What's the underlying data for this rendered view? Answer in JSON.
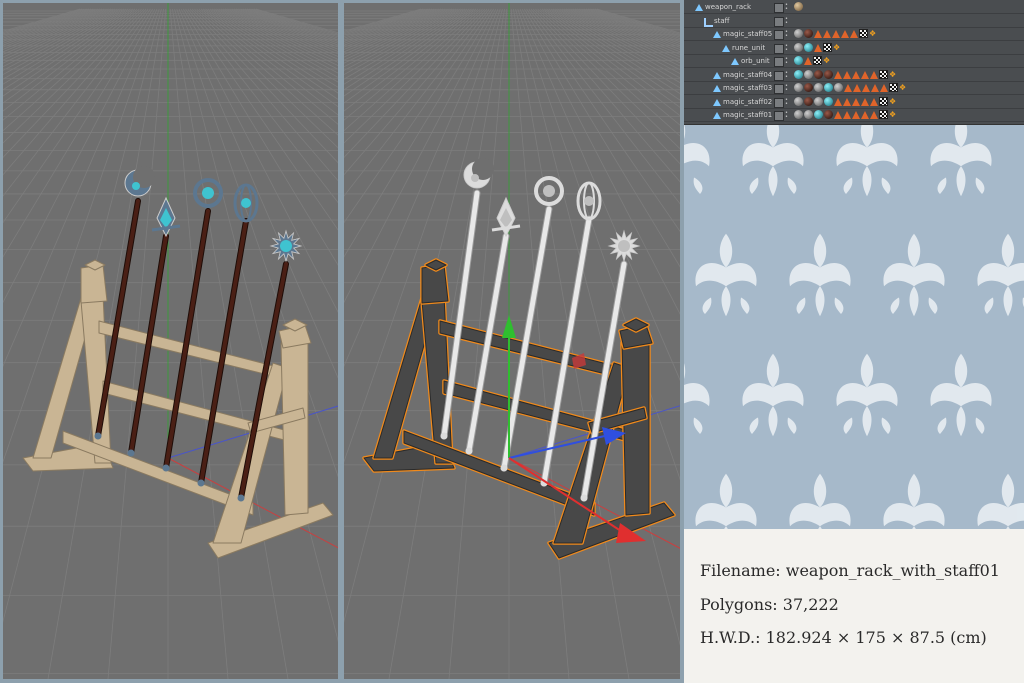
{
  "outliner": {
    "rows": [
      {
        "name": "weapon_rack",
        "kind": "null",
        "depth": 0,
        "tags": [
          "ball-brown"
        ]
      },
      {
        "name": "staff",
        "kind": "lod",
        "depth": 1,
        "tags": []
      },
      {
        "name": "magic_staff05",
        "kind": "poly",
        "depth": 2,
        "tags": [
          "ball-grey",
          "ball-dark",
          "tri",
          "tri",
          "tri",
          "tri",
          "tri",
          "checker",
          "phong"
        ]
      },
      {
        "name": "rune_unit",
        "kind": "poly",
        "depth": 3,
        "tags": [
          "ball-grey",
          "ball-cyan",
          "tri",
          "checker",
          "phong"
        ]
      },
      {
        "name": "orb_unit",
        "kind": "poly",
        "depth": 4,
        "tags": [
          "ball-cyan",
          "tri",
          "checker",
          "phong"
        ]
      },
      {
        "name": "magic_staff04",
        "kind": "poly",
        "depth": 2,
        "tags": [
          "ball-cyan",
          "ball-grey",
          "ball-dark",
          "ball-dark",
          "tri",
          "tri",
          "tri",
          "tri",
          "tri",
          "checker",
          "phong"
        ]
      },
      {
        "name": "magic_staff03",
        "kind": "poly",
        "depth": 2,
        "tags": [
          "ball-grey",
          "ball-dark",
          "ball-grey",
          "ball-cyan",
          "ball-grey",
          "tri",
          "tri",
          "tri",
          "tri",
          "tri",
          "checker",
          "phong"
        ]
      },
      {
        "name": "magic_staff02",
        "kind": "poly",
        "depth": 2,
        "tags": [
          "ball-grey",
          "ball-dark",
          "ball-grey",
          "ball-cyan",
          "tri",
          "tri",
          "tri",
          "tri",
          "tri",
          "checker",
          "phong"
        ]
      },
      {
        "name": "magic_staff01",
        "kind": "poly",
        "depth": 2,
        "tags": [
          "ball-grey",
          "ball-grey",
          "ball-cyan",
          "ball-dark",
          "tri",
          "tri",
          "tri",
          "tri",
          "tri",
          "checker",
          "phong"
        ]
      }
    ]
  },
  "info": {
    "filename": "Filename: weapon_rack_with_staff01",
    "polygons": "Polygons: 37,222",
    "hwd": "H.W.D.: 182.924 × 175 × 87.5 (cm)"
  },
  "colors": {
    "viewport_bg": "#6f6f6f",
    "grid_line": "#7d7d7d",
    "wood": "#c9b594",
    "wood_dark": "#8a7a60",
    "gem": "#3fc3d0",
    "shaft": "#4a1f15",
    "wire_fill": "#484848",
    "select_orange": "#f08a1c",
    "pattern_bg": "#a6b9ca",
    "pattern_fg": "#e8eef3"
  }
}
